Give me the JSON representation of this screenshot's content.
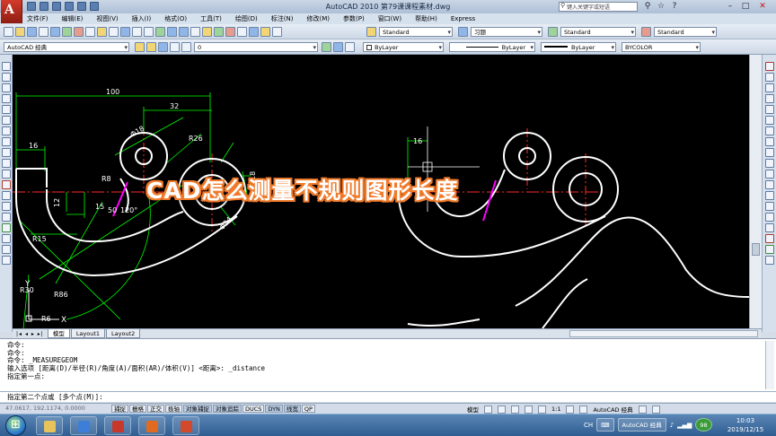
{
  "window": {
    "title": "AutoCAD 2010    第79课课程素材.dwg",
    "search_placeholder": "键入关键字或短语",
    "logo_letter": "A"
  },
  "menu": [
    "文件(F)",
    "编辑(E)",
    "视图(V)",
    "插入(I)",
    "格式(O)",
    "工具(T)",
    "绘图(D)",
    "标注(N)",
    "修改(M)",
    "参数(P)",
    "窗口(W)",
    "帮助(H)",
    "Express"
  ],
  "toolbar": {
    "workspace": "AutoCAD 经典",
    "text_style": "Standard",
    "dim_style": "习题",
    "table_style": "Standard",
    "multileader_style": "Standard",
    "layer": "0",
    "color": "ByLayer",
    "linetype": "ByLayer",
    "lineweight": "ByLayer",
    "plotstyle": "BYCOLOR"
  },
  "drawing": {
    "dim_labels": [
      "100",
      "32",
      "16",
      "R26",
      "R8",
      "120°",
      "R15",
      "R30",
      "R86",
      "R6",
      "12",
      "15",
      "50",
      "Φ34",
      "Φ18",
      "18",
      "16"
    ],
    "ucs_labels": [
      "Y",
      "X"
    ]
  },
  "overlay_title": "CAD怎么测量不规则图形长度",
  "tabs": [
    "模型",
    "Layout1",
    "Layout2"
  ],
  "command": {
    "history": [
      "命令:",
      "命令:",
      "命令: _MEASUREGEOM",
      "输入选项 [距离(D)/半径(R)/角度(A)/面积(AR)/体积(V)] <距离>: _distance",
      "指定第一点:"
    ],
    "prompt": "指定第二个点或 [多个点(M)]:"
  },
  "status": {
    "coords": "47.0617, 192.1174, 0.0000",
    "toggles": [
      "捕捉",
      "栅格",
      "正交",
      "极轴",
      "对象捕捉",
      "对象追踪",
      "DUCS",
      "DYN",
      "线宽",
      "QP"
    ],
    "model_label": "模型",
    "scale": "1:1",
    "workspace": "AutoCAD 经典"
  },
  "taskbar": {
    "lang": "CH",
    "time": "10:03",
    "date": "2019/12/15",
    "battery_badge": "98"
  },
  "colors": {
    "canvas": "#000000",
    "accent_orange": "#f07a2a",
    "dim_green": "#00ff00",
    "center_red": "#ff2a2a",
    "highlight_magenta": "#ff00ff"
  }
}
